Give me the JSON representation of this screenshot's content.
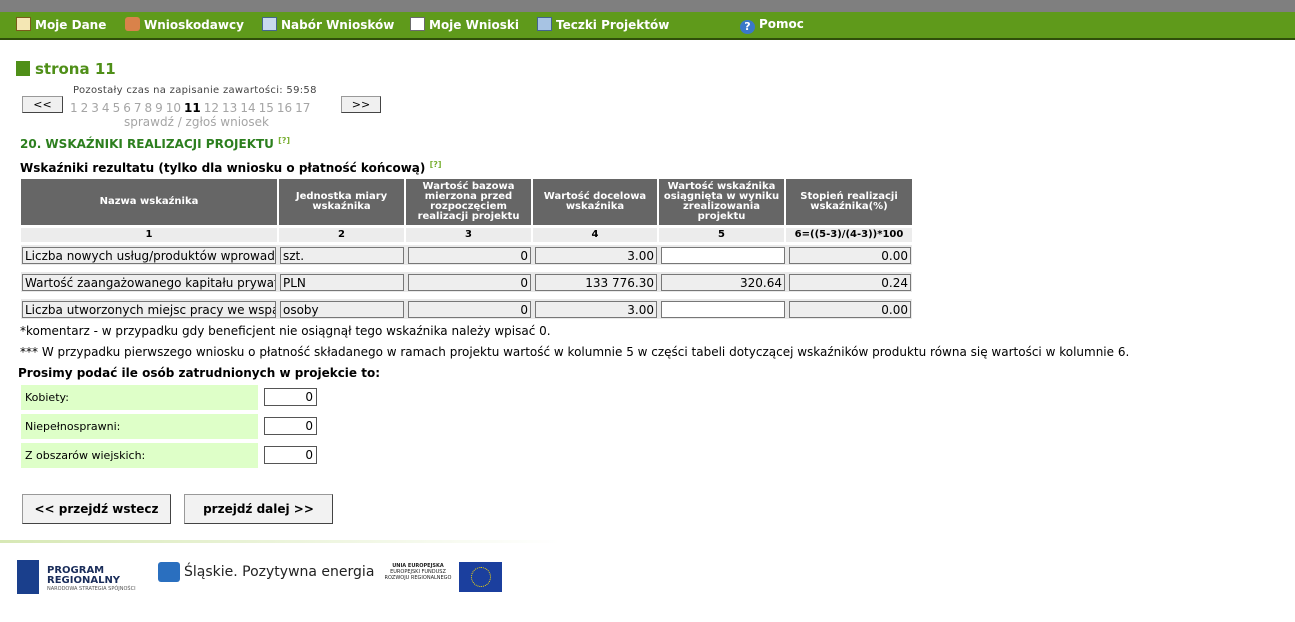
{
  "nav": [
    {
      "label": "Moje Dane",
      "icon": "user-card-icon"
    },
    {
      "label": "Wnioskodawcy",
      "icon": "people-icon"
    },
    {
      "label": "Nabór Wniosków",
      "icon": "form-icon"
    },
    {
      "label": "Moje Wnioski",
      "icon": "edit-document-icon"
    },
    {
      "label": "Teczki Projektów",
      "icon": "folder-icon"
    },
    {
      "label": "Pomoc",
      "icon": "help-icon"
    }
  ],
  "page": {
    "title": "strona 11",
    "timer": "Pozostały czas na zapisanie zawartości: 59:58",
    "prev": "<<",
    "next": ">>",
    "pages": [
      "1",
      "2",
      "3",
      "4",
      "5",
      "6",
      "7",
      "8",
      "9",
      "10",
      "11",
      "12",
      "13",
      "14",
      "15",
      "16",
      "17"
    ],
    "current_page": "11",
    "check_link": "sprawdź / zgłoś wniosek"
  },
  "section": {
    "title": "20. WSKAŹNIKI REALIZACJI PROJEKTU",
    "help": "[?]"
  },
  "table": {
    "subtitle": "Wskaźniki rezultatu (tylko dla wniosku o płatność końcową)",
    "help": "[?]",
    "headers": [
      "Nazwa wskaźnika",
      "Jednostka miary wskaźnika",
      "Wartość bazowa mierzona przed rozpoczęciem realizacji projektu",
      "Wartość docelowa wskaźnika",
      "Wartość wskaźnika osiągnięta w wyniku zrealizowania projektu",
      "Stopień realizacji wskaźnika(%)"
    ],
    "numbers": [
      "1",
      "2",
      "3",
      "4",
      "5",
      "6=((5-3)/(4-3))*100"
    ],
    "rows": [
      {
        "name": "Liczba nowych usług/produktów wprowadzonych",
        "unit": "szt.",
        "base": "0",
        "target": "3.00",
        "achieved": "",
        "degree": "0.00"
      },
      {
        "name": "Wartość zaangażowanego kapitału prywatnego",
        "unit": "PLN",
        "base": "0",
        "target": "133 776.30",
        "achieved": "320.64",
        "degree": "0.24"
      },
      {
        "name": "Liczba utworzonych miejsc pracy we wspa",
        "unit": "osoby",
        "base": "0",
        "target": "3.00",
        "achieved": "",
        "degree": "0.00"
      }
    ]
  },
  "notes": [
    "*komentarz - w przypadku gdy beneficjent nie osiągnął tego wskaźnika należy wpisać 0.",
    "*** W przypadku pierwszego wniosku o płatność składanego w ramach projektu wartość w kolumnie 5 w części tabeli dotyczącej wskaźników produktu równa się wartości w kolumnie 6."
  ],
  "employment": {
    "heading": "Prosimy podać ile osób zatrudnionych w projekcie to:",
    "fields": [
      {
        "label": "Kobiety:",
        "value": "0"
      },
      {
        "label": "Niepełnosprawni:",
        "value": "0"
      },
      {
        "label": "Z obszarów wiejskich:",
        "value": "0"
      }
    ]
  },
  "buttons": {
    "back": "<< przejdź wstecz",
    "next": "przejdź dalej >>"
  },
  "footer": {
    "logo1_line1": "PROGRAM",
    "logo1_line2": "REGIONALNY",
    "logo1_sub": "NARODOWA STRATEGIA SPÓJNOŚCI",
    "logo2": "Śląskie. Pozytywna energia",
    "eu_line1": "UNIA EUROPEJSKA",
    "eu_line2": "EUROPEJSKI FUNDUSZ",
    "eu_line3": "ROZWOJU REGIONALNEGO"
  }
}
